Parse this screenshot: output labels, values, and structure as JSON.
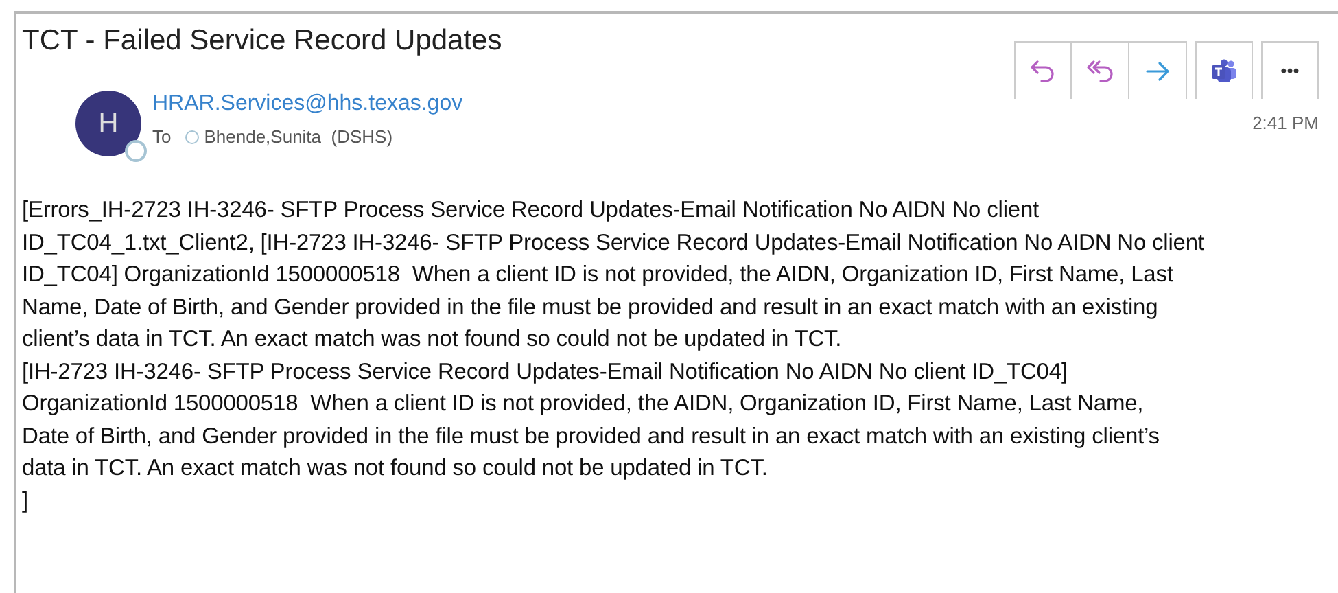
{
  "message": {
    "subject": "TCT - Failed Service Record Updates",
    "avatar_initial": "H",
    "sender": "HRAR.Services@hhs.texas.gov",
    "to_label": "To",
    "recipient": "Bhende,Sunita  (DSHS)",
    "time": "2:41 PM",
    "body_lines": [
      "[Errors_IH-2723 IH-3246- SFTP Process Service Record Updates-Email Notification No AIDN No client",
      "ID_TC04_1.txt_Client2, [IH-2723 IH-3246- SFTP Process Service Record Updates-Email Notification No AIDN No client",
      "ID_TC04] OrganizationId 1500000518  When a client ID is not provided, the AIDN, Organization ID, First Name, Last",
      "Name, Date of Birth, and Gender provided in the file must be provided and result in an exact match with an existing",
      "client’s data in TCT. An exact match was not found so could not be updated in TCT.",
      "[IH-2723 IH-3246- SFTP Process Service Record Updates-Email Notification No AIDN No client ID_TC04]",
      "OrganizationId 1500000518  When a client ID is not provided, the AIDN, Organization ID, First Name, Last Name,",
      "Date of Birth, and Gender provided in the file must be provided and result in an exact match with an existing client’s",
      "data in TCT. An exact match was not found so could not be updated in TCT.",
      "]"
    ]
  },
  "actions": [
    {
      "kind": "reply"
    },
    {
      "kind": "reply_all"
    },
    {
      "kind": "forward"
    },
    {
      "kind": "teams"
    },
    {
      "kind": "more",
      "label": "•••"
    }
  ]
}
